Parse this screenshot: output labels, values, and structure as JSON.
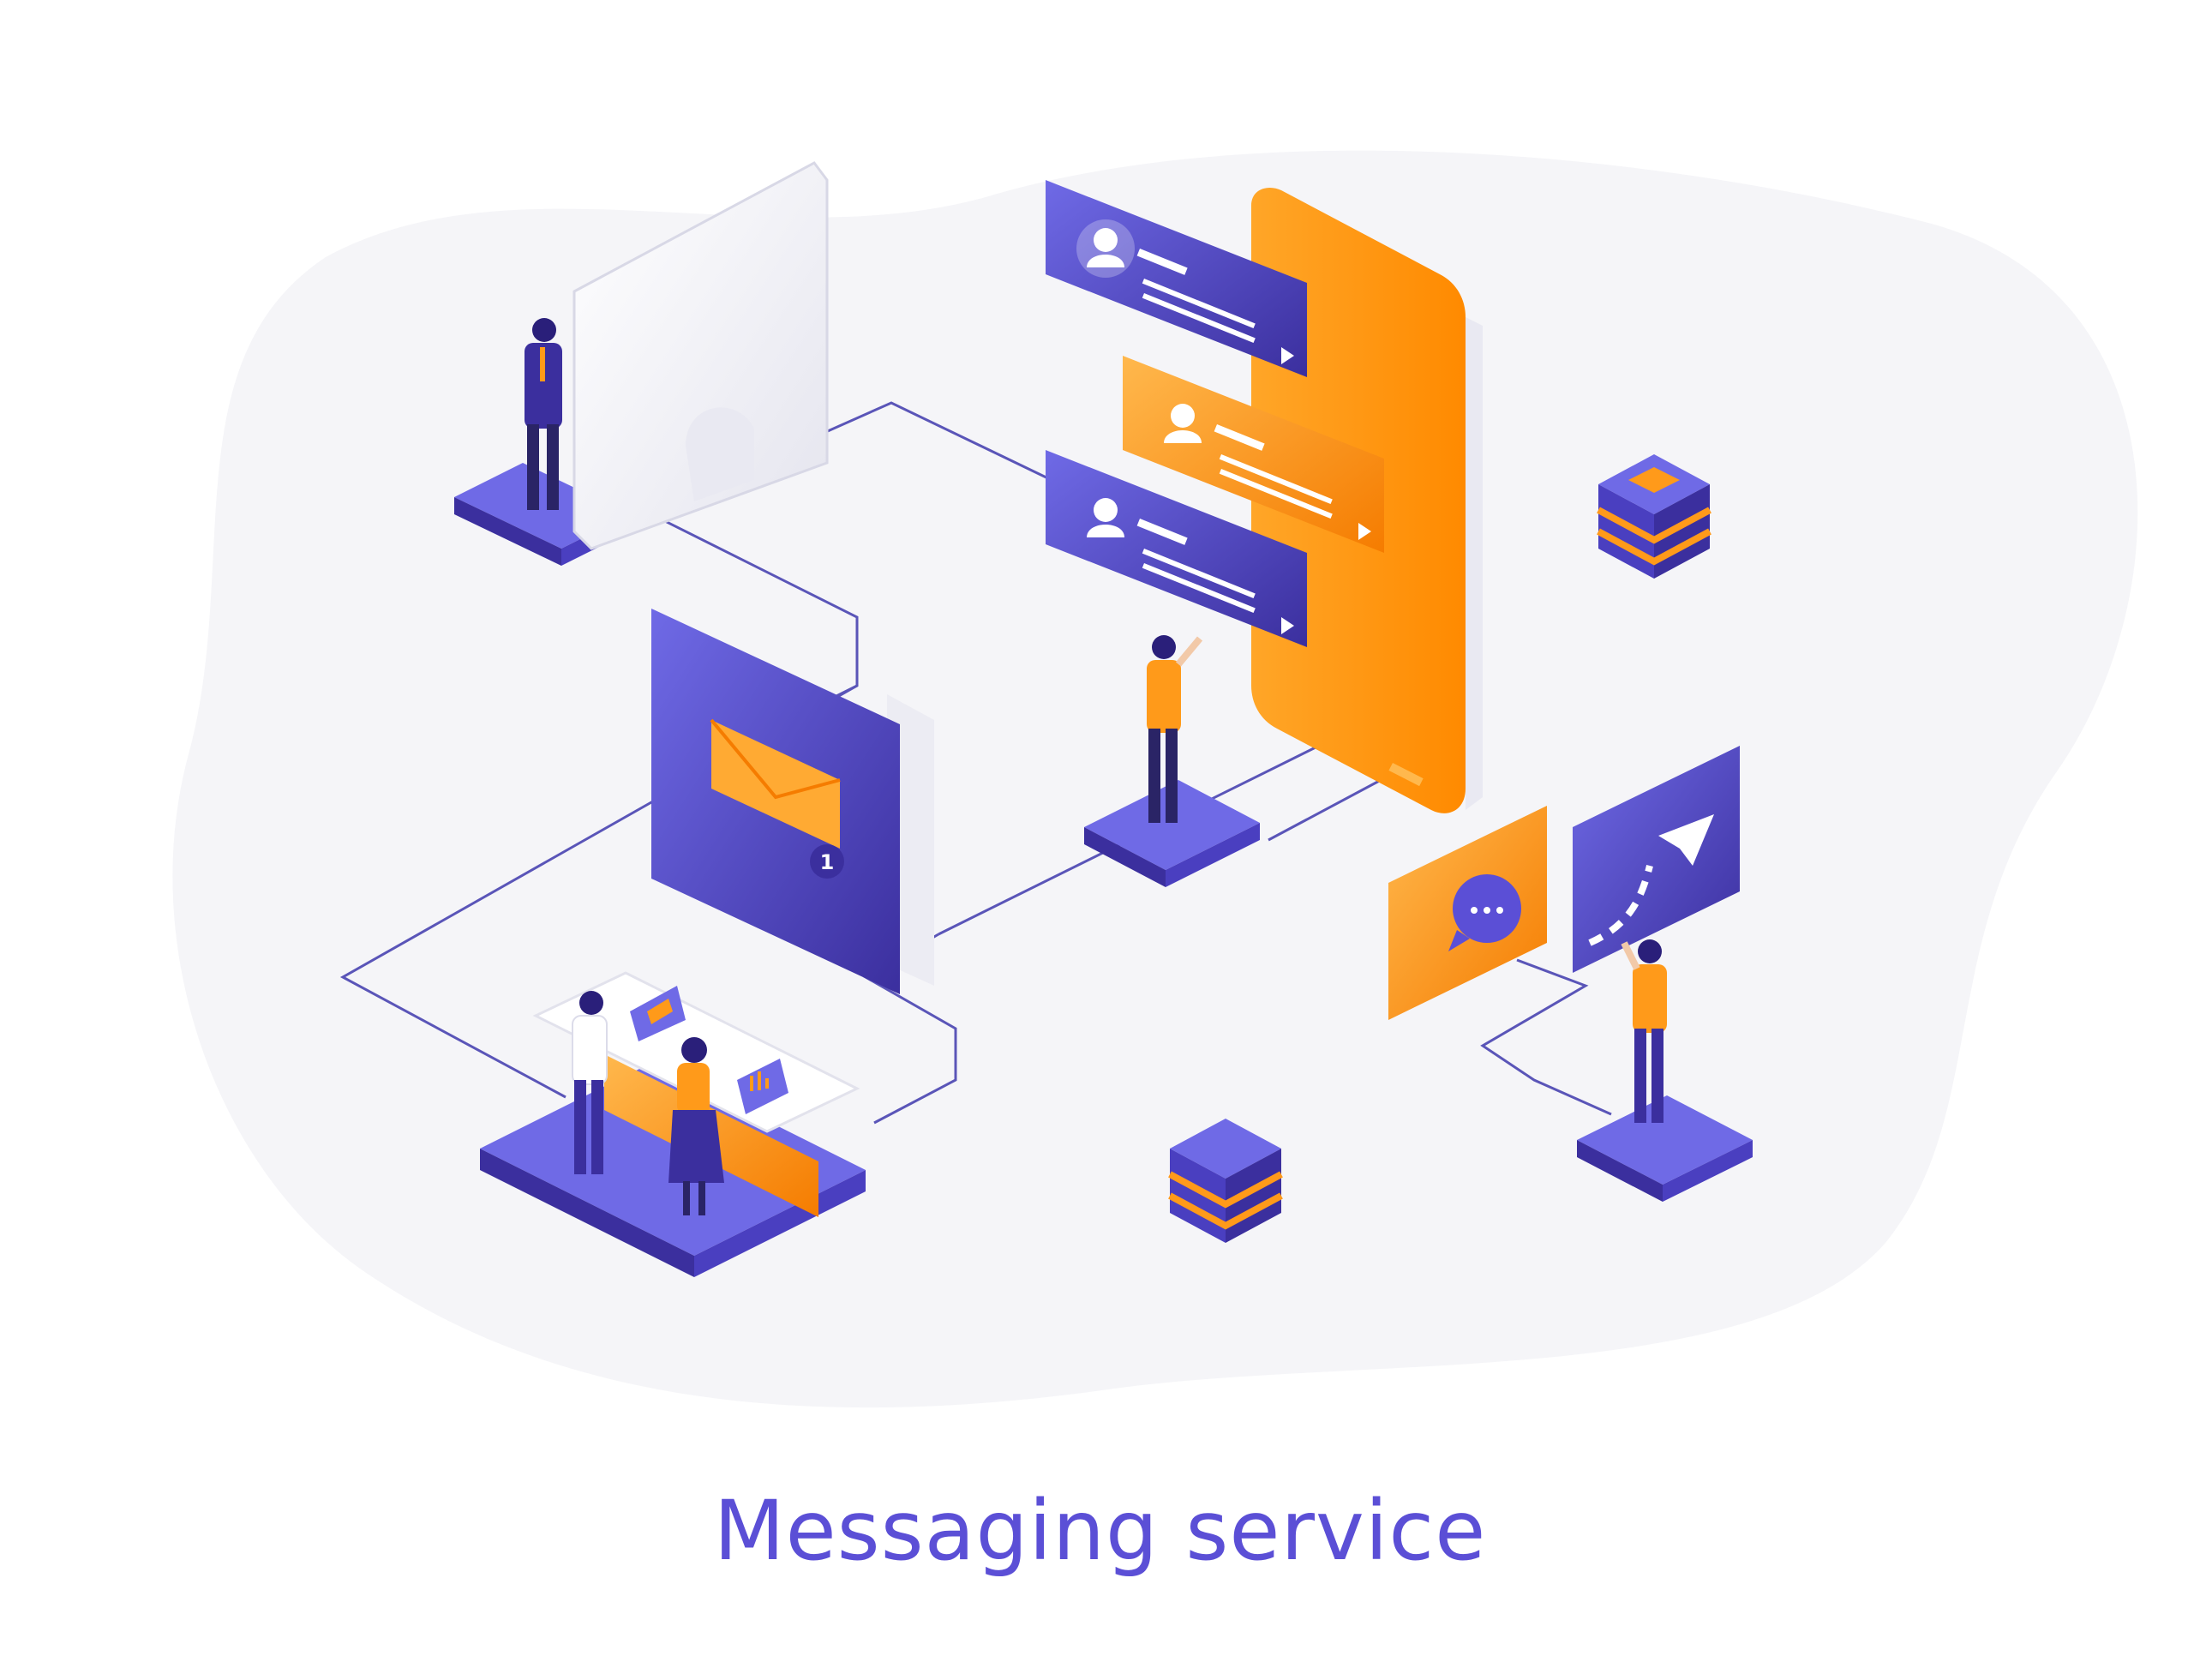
{
  "title": "Messaging service",
  "colors": {
    "purple": "#5b4fd6",
    "purple_dark": "#3b2f9e",
    "purple_light": "#6f6ae6",
    "orange": "#ff9a1a",
    "orange_dark": "#f57c00",
    "orange_light": "#ffc34d",
    "blob": "#f5f5f8",
    "panel_white": "#f1f1f6",
    "line": "#5a55b8"
  },
  "illustration": {
    "phone_cards": [
      {
        "style": "purple"
      },
      {
        "style": "orange"
      },
      {
        "style": "purple"
      }
    ],
    "tablet_badge": "1",
    "icons": [
      "mail-envelope-icon",
      "chat-bubble-icon",
      "paper-plane-icon",
      "user-avatar-icon"
    ],
    "people": [
      "businessman-at-monitor",
      "man-at-phone",
      "woman-at-laptop",
      "man-at-laptop",
      "man-at-plane-screen"
    ]
  }
}
